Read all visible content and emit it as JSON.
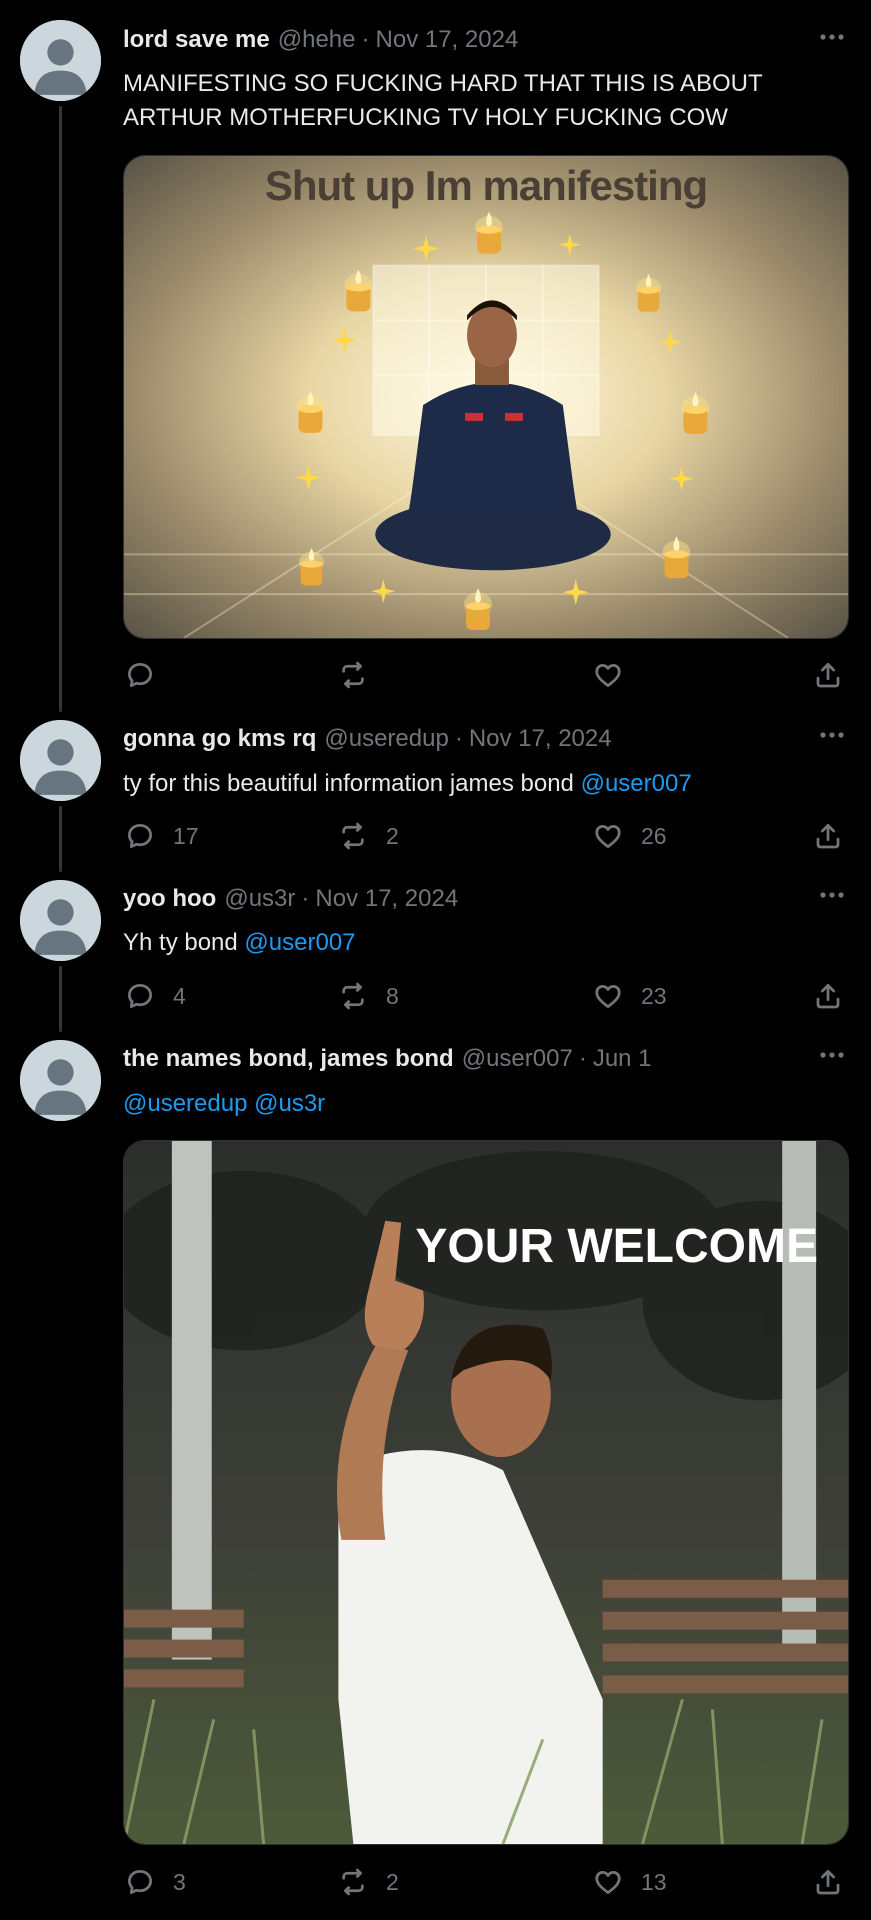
{
  "tweets": [
    {
      "display_name": "lord save me",
      "handle": "@hehe",
      "separator": "·",
      "date": "Nov 17, 2024",
      "text": "MANIFESTING SO FUCKING HARD THAT THIS IS ABOUT ARTHUR MOTHERFUCKING TV HOLY FUCKING COW",
      "media": {
        "caption": "Shut up Im manifesting",
        "description_icon": "meditation-image"
      },
      "counts": {
        "replies": "",
        "retweets": "",
        "likes": ""
      }
    },
    {
      "display_name": "gonna go kms rq",
      "handle": "@useredup",
      "separator": "·",
      "date": "Nov 17, 2024",
      "text": "ty for this beautiful information james bond ",
      "mention": "@user007",
      "counts": {
        "replies": "17",
        "retweets": "2",
        "likes": "26"
      }
    },
    {
      "display_name": "yoo hoo",
      "handle": "@us3r",
      "separator": "·",
      "date": "Nov 17, 2024",
      "text": "Yh ty bond ",
      "mention": "@user007",
      "counts": {
        "replies": "4",
        "retweets": "8",
        "likes": "23"
      }
    },
    {
      "display_name": "the names bond, james bond",
      "handle": "@user007",
      "separator": "·",
      "date": "Jun 1",
      "mention_1": "@useredup",
      "mention_2": "@us3r",
      "media": {
        "caption": "YOUR WELCOME",
        "description_icon": "thumbs-up-image"
      },
      "counts": {
        "replies": "3",
        "retweets": "2",
        "likes": "13"
      }
    }
  ],
  "colors": {
    "background": "#000000",
    "text": "#e7e9ea",
    "muted": "#71767b",
    "link": "#1d9bf0",
    "thread_line": "#333639",
    "avatar_bg": "#ccd6dd",
    "avatar_fg": "#66757f"
  },
  "icons": [
    "default-avatar",
    "more-icon",
    "reply-icon",
    "retweet-icon",
    "like-icon",
    "share-icon"
  ]
}
